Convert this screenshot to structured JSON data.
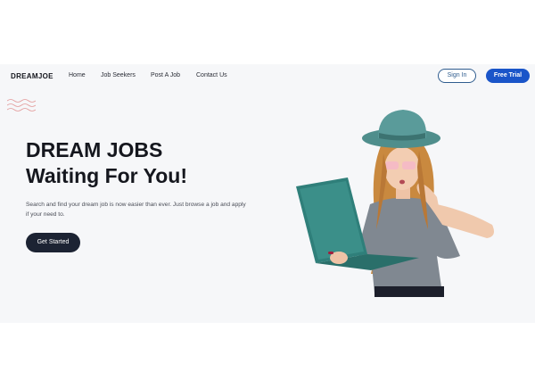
{
  "navbar": {
    "logo": "DREAMJOE",
    "links": [
      "Home",
      "Job Seekers",
      "Post A Job",
      "Contact Us"
    ],
    "signin_label": "Sign In",
    "trial_label": "Free Trial"
  },
  "hero": {
    "title_line1": "DREAM JOBS",
    "title_line2": "Waiting For You!",
    "description": "Search and find your dream job is now easier than ever. Just browse a job and apply if your need to.",
    "cta_label": "Get Started"
  },
  "colors": {
    "primary": "#1a55c9",
    "dark_button": "#1c2333",
    "hero_background": "#f6f7f9",
    "hat_teal": "#5a9b9a",
    "laptop_teal": "#2f7f7a"
  },
  "icons": {
    "decor": "wave-lines-icon",
    "illustration": "woman-with-laptop-illustration"
  }
}
